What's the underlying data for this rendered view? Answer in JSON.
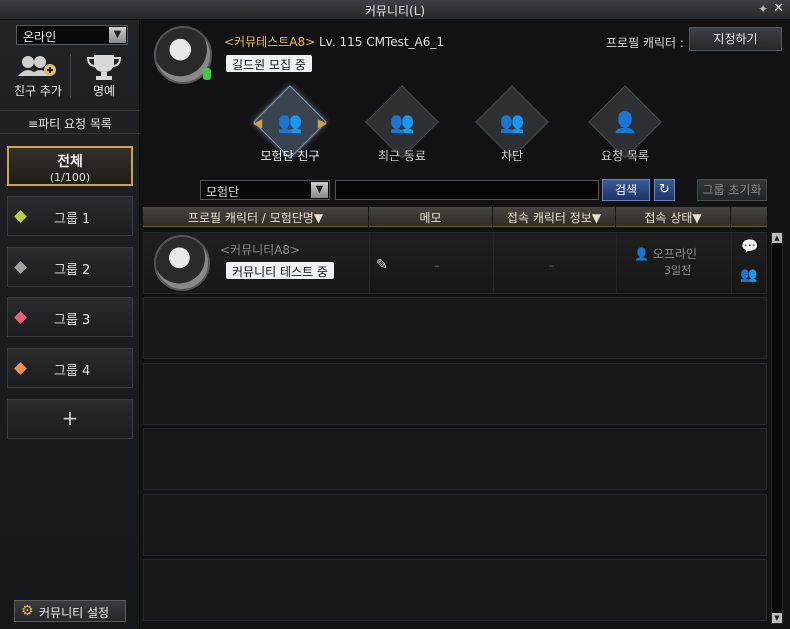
{
  "window": {
    "title": "커뮤니티(L)",
    "pin_glyph": "✦",
    "close_glyph": "✕"
  },
  "sidebar": {
    "status": "온라인",
    "add_friend_label": "친구 추가",
    "honor_label": "명예",
    "party_request_label": "≡파티 요청 목록",
    "groups": {
      "all_label": "전체",
      "all_count": "(1/100)",
      "group1": {
        "label": "그룹 1",
        "color": "#b8d040"
      },
      "group2": {
        "label": "그룹 2",
        "color": "#a0a0a0"
      },
      "group3": {
        "label": "그룹 3",
        "color": "#e86070"
      },
      "group4": {
        "label": "그룹 4",
        "color": "#f09050"
      },
      "add_glyph": "+"
    },
    "settings_label": "커뮤니티 설정"
  },
  "profile": {
    "name": "<커뮤테스트A8>",
    "level": "Lv. 115 CMTest_A6_1",
    "status_message": "길드원 모집 중",
    "profile_character_label": "프로필 캐릭터 :",
    "assign_button": "지정하기"
  },
  "tabs": [
    {
      "label": "모험단 친구",
      "icon": "people-group-icon"
    },
    {
      "label": "최근 동료",
      "icon": "recent-people-icon"
    },
    {
      "label": "차단",
      "icon": "block-people-icon"
    },
    {
      "label": "요청 목록",
      "icon": "request-list-icon"
    }
  ],
  "filter": {
    "selected": "모험단",
    "search_value": "",
    "search_button": "검색",
    "reset_button": "그룹 초기화"
  },
  "table": {
    "headers": {
      "profile": "프로필 캐릭터 / 모험단명▼",
      "memo": "메모",
      "char_info": "접속 캐릭터 정보▼",
      "status": "접속 상태▼"
    },
    "rows": [
      {
        "name": "<커뮤니티A8>",
        "message": "커뮤니티 테스트 중",
        "memo": "–",
        "char_info": "–",
        "status": "오프라인",
        "last_seen": "3일전"
      }
    ]
  },
  "colors": {
    "accent_gold": "#c9a44a",
    "search_blue": "#2a4780"
  }
}
